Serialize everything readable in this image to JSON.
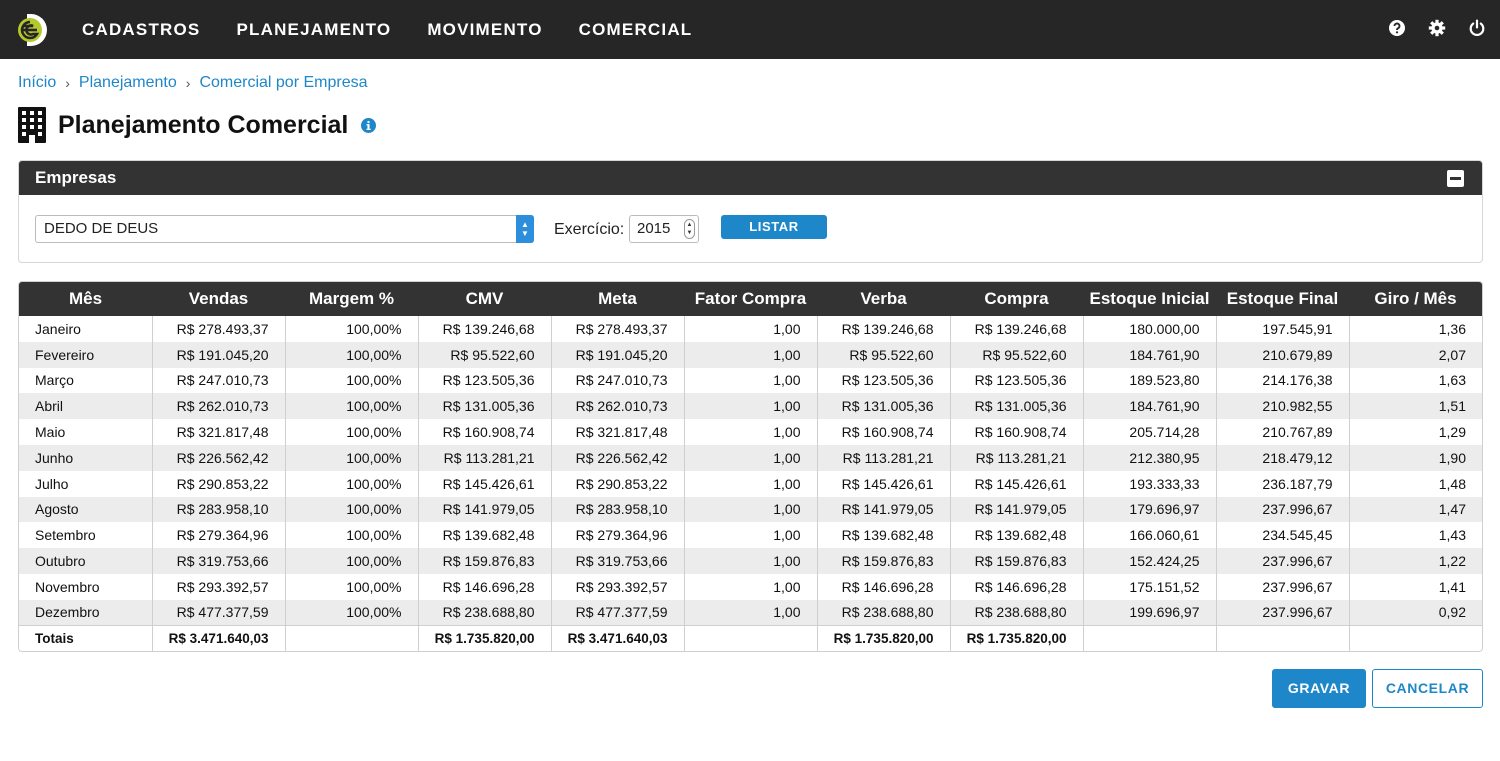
{
  "header": {
    "logo_icon": "e-logo-icon",
    "nav": [
      "CADASTROS",
      "PLANEJAMENTO",
      "MOVIMENTO",
      "COMERCIAL"
    ],
    "icons": [
      "help-icon",
      "gear-icon",
      "power-icon"
    ]
  },
  "breadcrumb": [
    "Início",
    "Planejamento",
    "Comercial por Empresa"
  ],
  "page": {
    "title": "Planejamento Comercial",
    "title_icon": "building-icon",
    "info_icon": "info-icon"
  },
  "empresas": {
    "title": "Empresas",
    "company_value": "DEDO DE DEUS",
    "exercicio_label": "Exercício:",
    "exercicio_value": "2015",
    "listar_label": "LISTAR"
  },
  "table": {
    "headers": [
      "Mês",
      "Vendas",
      "Margem %",
      "CMV",
      "Meta",
      "Fator Compra",
      "Verba",
      "Compra",
      "Estoque Inicial",
      "Estoque Final",
      "Giro / Mês"
    ],
    "rows": [
      [
        "Janeiro",
        "R$ 278.493,37",
        "100,00%",
        "R$ 139.246,68",
        "R$ 278.493,37",
        "1,00",
        "R$ 139.246,68",
        "R$ 139.246,68",
        "180.000,00",
        "197.545,91",
        "1,36"
      ],
      [
        "Fevereiro",
        "R$ 191.045,20",
        "100,00%",
        "R$ 95.522,60",
        "R$ 191.045,20",
        "1,00",
        "R$ 95.522,60",
        "R$ 95.522,60",
        "184.761,90",
        "210.679,89",
        "2,07"
      ],
      [
        "Março",
        "R$ 247.010,73",
        "100,00%",
        "R$ 123.505,36",
        "R$ 247.010,73",
        "1,00",
        "R$ 123.505,36",
        "R$ 123.505,36",
        "189.523,80",
        "214.176,38",
        "1,63"
      ],
      [
        "Abril",
        "R$ 262.010,73",
        "100,00%",
        "R$ 131.005,36",
        "R$ 262.010,73",
        "1,00",
        "R$ 131.005,36",
        "R$ 131.005,36",
        "184.761,90",
        "210.982,55",
        "1,51"
      ],
      [
        "Maio",
        "R$ 321.817,48",
        "100,00%",
        "R$ 160.908,74",
        "R$ 321.817,48",
        "1,00",
        "R$ 160.908,74",
        "R$ 160.908,74",
        "205.714,28",
        "210.767,89",
        "1,29"
      ],
      [
        "Junho",
        "R$ 226.562,42",
        "100,00%",
        "R$ 113.281,21",
        "R$ 226.562,42",
        "1,00",
        "R$ 113.281,21",
        "R$ 113.281,21",
        "212.380,95",
        "218.479,12",
        "1,90"
      ],
      [
        "Julho",
        "R$ 290.853,22",
        "100,00%",
        "R$ 145.426,61",
        "R$ 290.853,22",
        "1,00",
        "R$ 145.426,61",
        "R$ 145.426,61",
        "193.333,33",
        "236.187,79",
        "1,48"
      ],
      [
        "Agosto",
        "R$ 283.958,10",
        "100,00%",
        "R$ 141.979,05",
        "R$ 283.958,10",
        "1,00",
        "R$ 141.979,05",
        "R$ 141.979,05",
        "179.696,97",
        "237.996,67",
        "1,47"
      ],
      [
        "Setembro",
        "R$ 279.364,96",
        "100,00%",
        "R$ 139.682,48",
        "R$ 279.364,96",
        "1,00",
        "R$ 139.682,48",
        "R$ 139.682,48",
        "166.060,61",
        "234.545,45",
        "1,43"
      ],
      [
        "Outubro",
        "R$ 319.753,66",
        "100,00%",
        "R$ 159.876,83",
        "R$ 319.753,66",
        "1,00",
        "R$ 159.876,83",
        "R$ 159.876,83",
        "152.424,25",
        "237.996,67",
        "1,22"
      ],
      [
        "Novembro",
        "R$ 293.392,57",
        "100,00%",
        "R$ 146.696,28",
        "R$ 293.392,57",
        "1,00",
        "R$ 146.696,28",
        "R$ 146.696,28",
        "175.151,52",
        "237.996,67",
        "1,41"
      ],
      [
        "Dezembro",
        "R$ 477.377,59",
        "100,00%",
        "R$ 238.688,80",
        "R$ 477.377,59",
        "1,00",
        "R$ 238.688,80",
        "R$ 238.688,80",
        "199.696,97",
        "237.996,67",
        "0,92"
      ]
    ],
    "totals": [
      "Totais",
      "R$ 3.471.640,03",
      "",
      "R$ 1.735.820,00",
      "R$ 3.471.640,03",
      "",
      "R$ 1.735.820,00",
      "R$ 1.735.820,00",
      "",
      "",
      ""
    ]
  },
  "actions": {
    "gravar": "GRAVAR",
    "cancelar": "CANCELAR"
  },
  "colors": {
    "topbar": "#262626",
    "panel_header": "#333333",
    "accent": "#1e87c9",
    "logo_accent": "#b5c92b"
  }
}
